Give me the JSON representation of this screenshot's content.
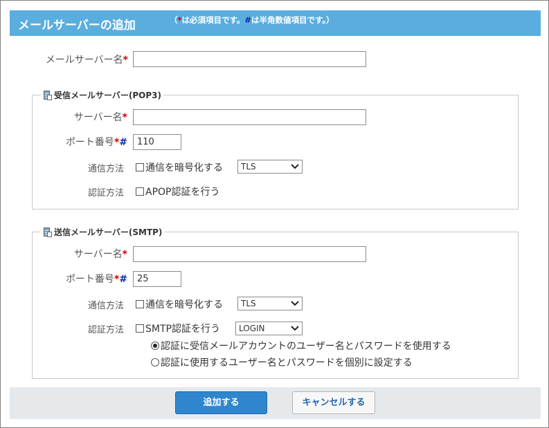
{
  "header": {
    "title": "メールサーバーの追加",
    "note_open": "（",
    "note_req_mark": "*",
    "note_req_text": "は必須項目です。",
    "note_hash_mark": "#",
    "note_hash_text": "は半角数値項目です。）"
  },
  "marks": {
    "required": "*",
    "numeric": "#"
  },
  "server_name": {
    "label": "メールサーバー名",
    "value": ""
  },
  "pop3": {
    "legend": "受信メールサーバー(POP3)",
    "server_label": "サーバー名",
    "server_value": "",
    "port_label": "ポート番号",
    "port_value": "110",
    "comm_label": "通信方法",
    "encrypt_label": "通信を暗号化する",
    "encrypt_select": "TLS",
    "auth_label": "認証方法",
    "apop_label": "APOP認証を行う"
  },
  "smtp": {
    "legend": "送信メールサーバー(SMTP)",
    "server_label": "サーバー名",
    "server_value": "",
    "port_label": "ポート番号",
    "port_value": "25",
    "comm_label": "通信方法",
    "encrypt_label": "通信を暗号化する",
    "encrypt_select": "TLS",
    "auth_label": "認証方法",
    "smtp_auth_label": "SMTP認証を行う",
    "auth_select": "LOGIN",
    "radio_1": "認証に受信メールアカウントのユーザー名とパスワードを使用する",
    "radio_2": "認証に使用するユーザー名とパスワードを個別に設定する"
  },
  "buttons": {
    "add": "追加する",
    "cancel": "キャンセルする"
  },
  "colors": {
    "header_bg": "#5aaedf",
    "primary": "#2f86cf",
    "footer_bg": "#e6e9ec",
    "required": "#cc0000",
    "numeric": "#0b2aa6"
  }
}
